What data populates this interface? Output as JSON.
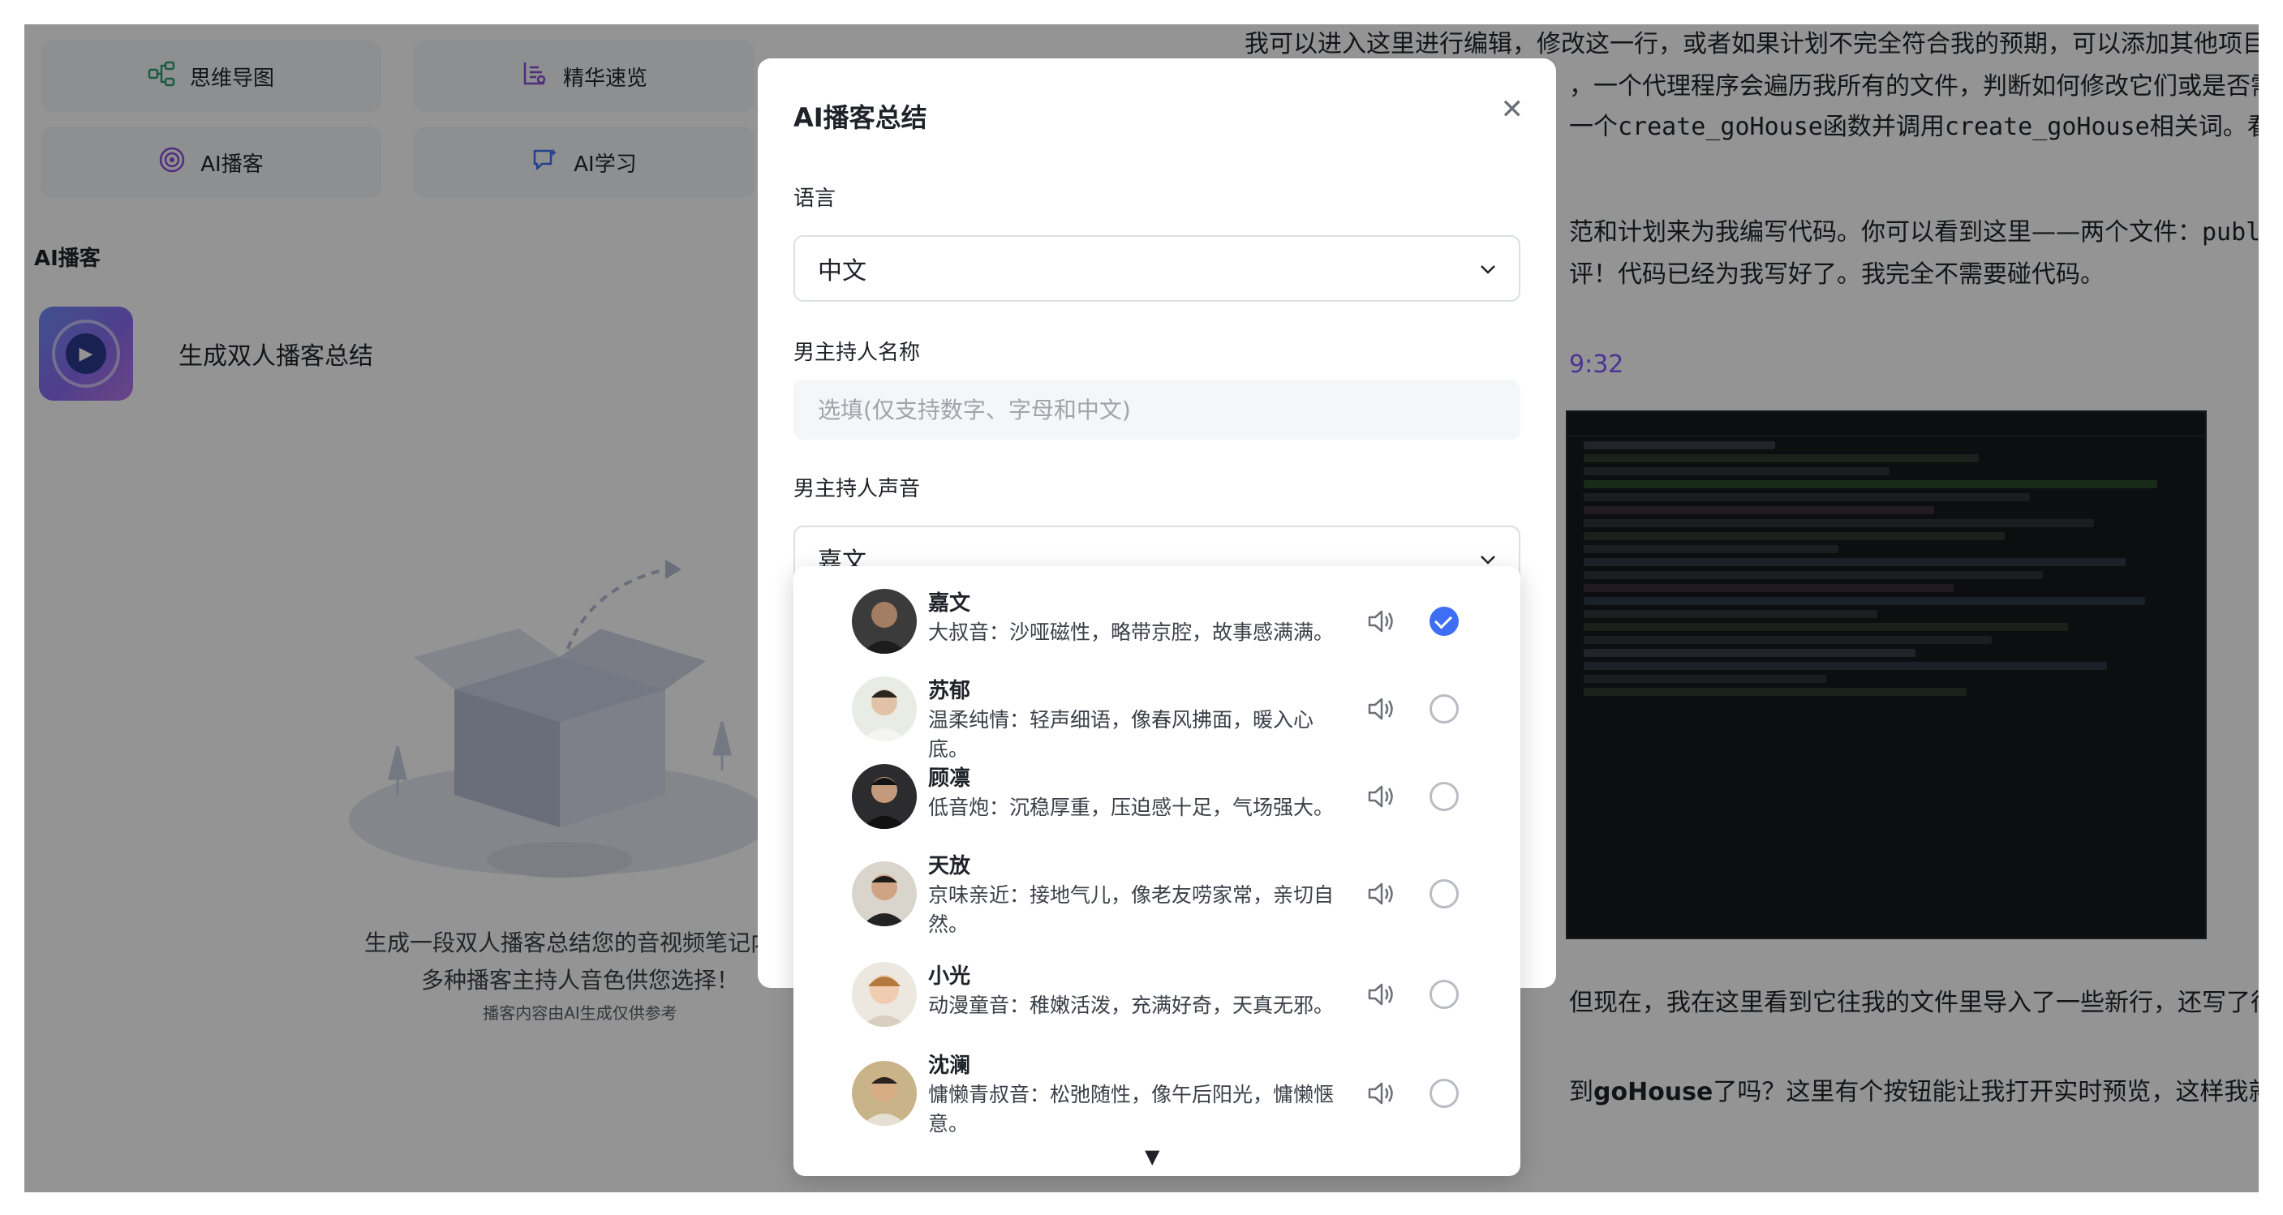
{
  "left": {
    "tools": [
      {
        "label": "思维导图",
        "icon": "mindmap-icon",
        "color": "#2f9e6e"
      },
      {
        "label": "精华速览",
        "icon": "summary-icon",
        "color": "#8a4fd6"
      },
      {
        "label": "AI播客",
        "icon": "podcast-icon",
        "color": "#8a4fd6"
      },
      {
        "label": "AI学习",
        "icon": "ai-learn-icon",
        "color": "#3d6ef5"
      }
    ],
    "section_title": "AI播客",
    "generate_label": "生成双人播客总结",
    "empty_line1": "生成一段双人播客总结您的音视频笔记内容",
    "empty_line2": "多种播客主持人音色供您选择！",
    "empty_note": "播客内容由AI生成仅供参考"
  },
  "doc": {
    "line1": "我可以进入这里进行编辑，修改这一行，或者如果计划不完全符合我的预期，可以添加其他项目。",
    "line2a": "，一个代理程序会遍历我所有的文件，判断如何修改它们或是否需",
    "line3a": "一个",
    "line3_code1": "create_goHouse",
    "line3b": "函数并调用",
    "line3_code2": "create_goHouse",
    "line3c": "相关词。看",
    "line4a": "范和计划来为我编写代码。你可以看到这里——两个文件：",
    "line4_code": "publi",
    "line5": "评！代码已经为我写好了。我完全不需要碰代码。",
    "timestamp": "9:32",
    "line6": "但现在，我在这里看到它往我的文件里导入了一些新行，还写了很多",
    "line7a": "到",
    "line7_bold": "goHouse",
    "line7b": "了吗？这里有个按钮能让我打开实时预览，这样我就能操"
  },
  "modal": {
    "title": "AI播客总结",
    "language_label": "语言",
    "language_value": "中文",
    "male_name_label": "男主持人名称",
    "male_name_placeholder": "选填(仅支持数字、字母和中文)",
    "male_name_value": "",
    "male_voice_label": "男主持人声音",
    "male_voice_value": "嘉文"
  },
  "voices": [
    {
      "name": "嘉文",
      "desc": "大叔音：沙哑磁性，略带京腔，故事感满满。",
      "selected": true
    },
    {
      "name": "苏郁",
      "desc": "温柔纯情：轻声细语，像春风拂面，暖入心底。",
      "selected": false
    },
    {
      "name": "顾凛",
      "desc": "低音炮：沉稳厚重，压迫感十足，气场强大。",
      "selected": false
    },
    {
      "name": "天放",
      "desc": "京味亲近：接地气儿，像老友唠家常，亲切自然。",
      "selected": false
    },
    {
      "name": "小光",
      "desc": "动漫童音：稚嫩活泼，充满好奇，天真无邪。",
      "selected": false
    },
    {
      "name": "沈澜",
      "desc": "慵懒青叔音：松弛随性，像午后阳光，慵懒惬意。",
      "selected": false
    }
  ],
  "colors": {
    "accent": "#3d6ef5",
    "timestamp": "#7c5cff",
    "overlay": "rgba(0,0,0,0.42)"
  }
}
